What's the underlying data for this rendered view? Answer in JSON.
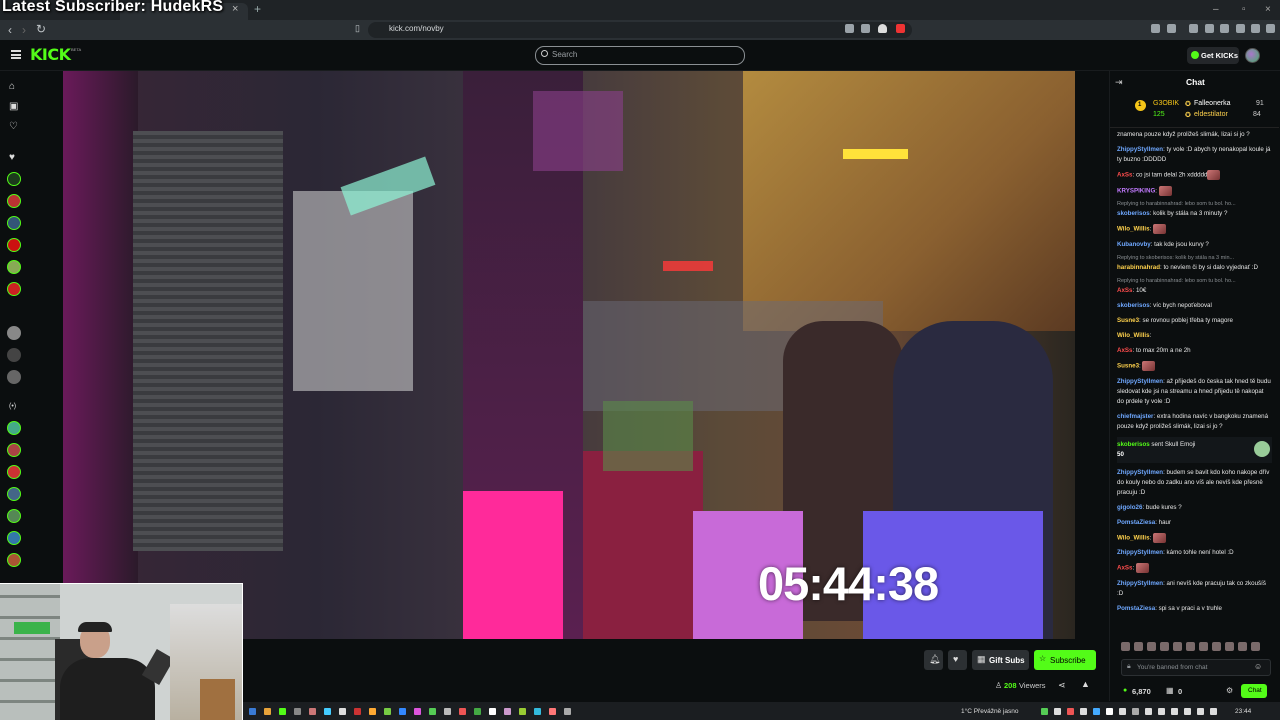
{
  "overlay": {
    "banner": "Latest Subscriber: HudekRS"
  },
  "browser": {
    "url": "kick.com/novby",
    "tab_close": "×",
    "new_tab": "+",
    "back": "‹",
    "forward": "›",
    "reload": "↻"
  },
  "header": {
    "search_placeholder": "Search",
    "get_kicks_label": "Get KICKs",
    "logo": "KICK",
    "logo_badge": "BETA"
  },
  "video": {
    "timer": "05:44:38"
  },
  "actions": {
    "gift_subs": "Gift Subs",
    "subscribe": "Subscribe",
    "viewers_count": "208",
    "viewers_label": "Viewers"
  },
  "chat": {
    "title": "Chat",
    "leaderboard": [
      {
        "name": "G3OBIK",
        "rank": "1",
        "count": "125"
      },
      {
        "name": "Falleonerka",
        "count": "91"
      },
      {
        "name": "eldestilator",
        "count": "84"
      }
    ],
    "messages": [
      {
        "user": "",
        "text": "znamena pouze když proližeš slimák, lizai si jo ?",
        "color": "#e8e8e8"
      },
      {
        "user": "ZhippyStyllmen",
        "text": "ty vole :D abych ty nenakopal koule já ty buzno :DDDDD",
        "color": "#6fa8ff"
      },
      {
        "user": "AxSs",
        "text": "co jsi tam delal 2h xddddd",
        "color": "#ff4d4d",
        "emote": true
      },
      {
        "user": "KRYSPIKING",
        "text": "",
        "color": "#c27bff",
        "emote": true
      },
      {
        "reply": "Replying to harabinnahrad: lebo som tu bol. ho...",
        "user": "skoberisos",
        "text": "kolik by stála na 3 minuty ?",
        "color": "#6fa8ff"
      },
      {
        "user": "Wilo_Willis",
        "text": "",
        "color": "#ffd24d",
        "emote": true
      },
      {
        "user": "Kubanovby",
        "text": "tak kde jsou kurvy ?",
        "color": "#6fa8ff"
      },
      {
        "reply": "Replying to skoberisos: kolik by stála na 3 min...",
        "user": "harabinnahrad",
        "text": "to nevíem či by si dalo vyjednať :D",
        "color": "#ffd24d"
      },
      {
        "reply": "Replying to harabinnahrad: lebo som tu bol. ho...",
        "user": "AxSs",
        "text": "10€",
        "color": "#ff4d4d"
      },
      {
        "user": "skoberisos",
        "text": "víc bych nepoťeboval",
        "color": "#6fa8ff"
      },
      {
        "user": "Susne3",
        "text": "se rovnou poblej třeba ty magore",
        "color": "#ffd24d"
      },
      {
        "user": "Wilo_Willis",
        "text": "",
        "color": "#ffd24d"
      },
      {
        "user": "AxSs",
        "text": "to max 20m a ne 2h",
        "color": "#ff4d4d"
      },
      {
        "user": "Susne3",
        "text": "",
        "color": "#ffd24d",
        "emote": true
      },
      {
        "user": "ZhippyStyllmen",
        "text": "až přijedeš do česka tak hned tě budu sledovat kde jsi na streamu a hned přijedu tě nakopat do prdele ty vole :D",
        "color": "#6fa8ff"
      },
      {
        "user": "chiefmajster",
        "text": "extra hodina navíc v bangkoku znamená pouze když proližeš slimák, lizai si jo ?",
        "color": "#6fa8ff"
      }
    ],
    "gift": {
      "user": "skoberisos",
      "text": "sent Skull Emoji",
      "amount": "50"
    },
    "messages2": [
      {
        "user": "ZhippyStyllmen",
        "text": "budem se bavit kdo koho nakope dřív do kouly nebo do zadku ano víš ale nevíš kde přesně pracuju :D",
        "color": "#6fa8ff"
      },
      {
        "user": "gigolo26",
        "text": "bude kures ?",
        "color": "#6fa8ff"
      },
      {
        "user": "PomstaZiesa",
        "text": "haur",
        "color": "#6fa8ff"
      },
      {
        "user": "Wilo_Willis",
        "text": "",
        "color": "#ffd24d",
        "emote": true
      },
      {
        "user": "ZhippyStyllmen",
        "text": "kámo tohle není hotel :D",
        "color": "#6fa8ff"
      },
      {
        "user": "AxSs",
        "text": "",
        "color": "#ff4d4d",
        "emote": true
      },
      {
        "user": "ZhippyStyllmen",
        "text": "ani nevíš kde pracuju tak co zkoušíš :D",
        "color": "#6fa8ff"
      },
      {
        "user": "PomstaZiesa",
        "text": "spi sa v praci a v truhle",
        "color": "#6fa8ff"
      }
    ],
    "input_placeholder": "You're banned from chat",
    "kicks": "6,870",
    "gifts": "0",
    "send_label": "Chat"
  },
  "taskbar": {
    "weather": "1°C  Převážně jasno",
    "time": "23:44"
  },
  "colors": {
    "accent": "#53fc18",
    "bg": "#0b0e0f"
  }
}
